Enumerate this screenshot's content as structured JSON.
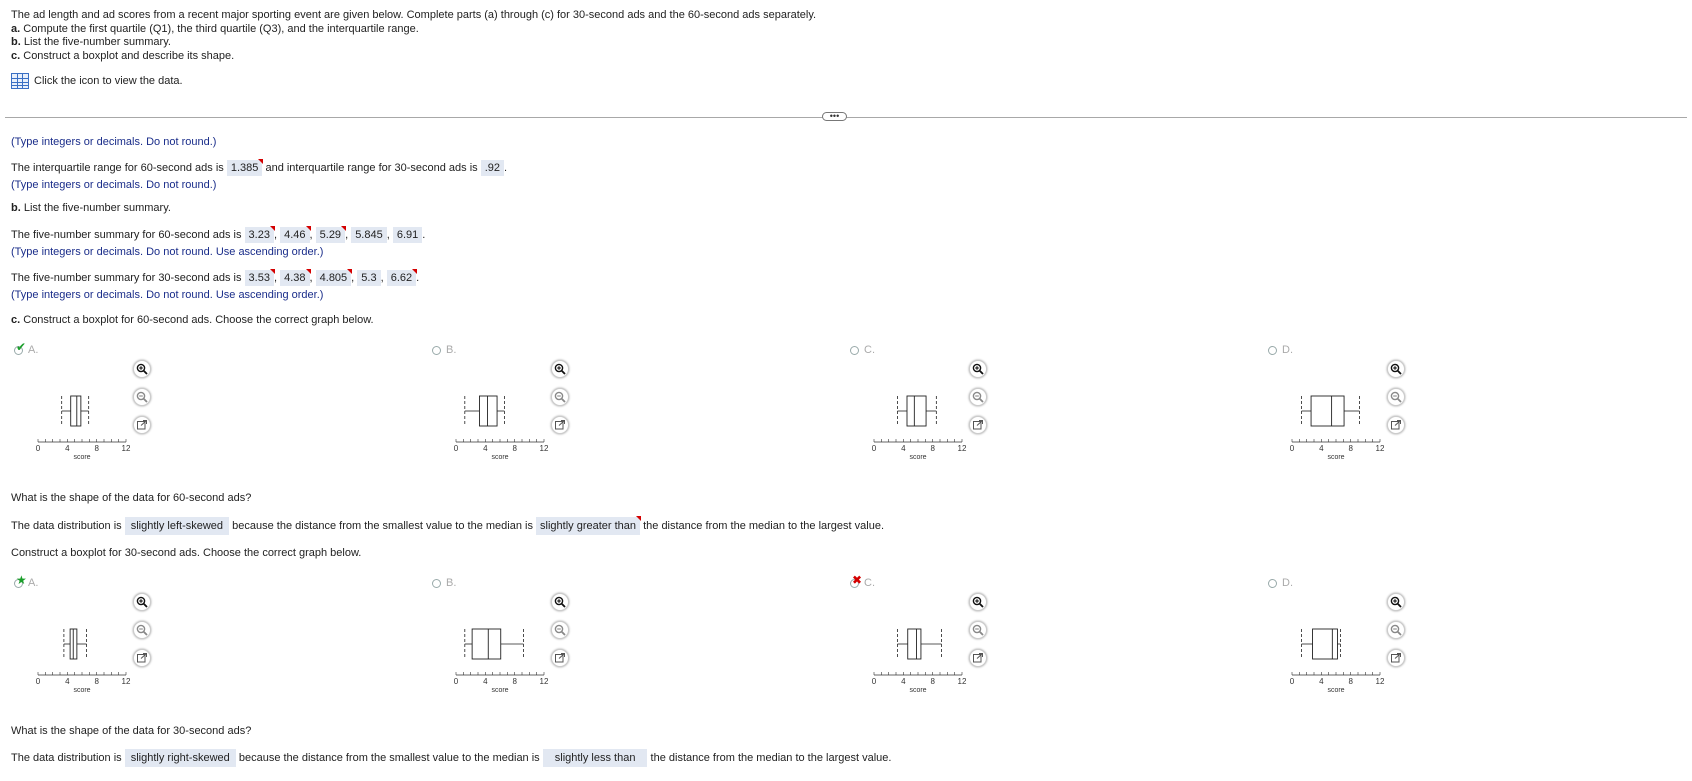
{
  "intro": {
    "line1": "The ad length and ad scores from a recent major sporting event are given below. Complete parts (a) through (c) for 30-second ads and the 60-second ads separately.",
    "a_label": "a.",
    "a_text": " Compute the first quartile (Q1), the third quartile (Q3), and the interquartile range.",
    "b_label": "b.",
    "b_text": " List the five-number summary.",
    "c_label": "c.",
    "c_text": " Construct a boxplot and describe its shape."
  },
  "data_link": "Click the icon to view the data.",
  "divider_handle": "•••",
  "hint_round": "(Type integers or decimals. Do not round.)",
  "iqr": {
    "pre": "The interquartile range for 60-second ads is",
    "iqr60": "1.385",
    "mid": "and interquartile range for 30-second ads is",
    "iqr30": ".92",
    "post": "."
  },
  "b_heading_label": "b.",
  "b_heading_text": " List the five-number summary.",
  "five60": {
    "pre": "The five-number summary for 60-second ads is",
    "values": [
      "3.23",
      "4.46",
      "5.29",
      "5.845",
      "6.91"
    ]
  },
  "five30": {
    "pre": "The five-number summary for 30-second ads is",
    "values": [
      "3.53",
      "4.38",
      "4.805",
      "5.3",
      "6.62"
    ]
  },
  "hint_asc": "(Type integers or decimals. Do not round. Use ascending order.)",
  "comma": ",",
  "period": ".",
  "c_heading_label": "c.",
  "c_heading_text": " Construct a boxplot for 60-second ads. Choose the correct graph below.",
  "q30_heading": "Construct a boxplot for 30-second ads. Choose the correct graph below.",
  "shape60_q": "What is the shape of the data for 60-second ads?",
  "shape30_q": "What is the shape of the data for 30-second ads?",
  "shape60": {
    "pre": "The data distribution is",
    "shape": "slightly left-skewed",
    "mid": "because the distance from the smallest value to the median is",
    "cmp": "slightly greater than",
    "post": "the distance from the median to the largest value."
  },
  "shape30": {
    "pre": "The data distribution is",
    "shape": "slightly right-skewed",
    "mid": "because the distance from the smallest value to the median is",
    "cmp": "slightly less than",
    "post": "the distance from the median to the largest value."
  },
  "options_letters": [
    "A.",
    "B.",
    "C.",
    "D."
  ],
  "axis": {
    "label": "score",
    "ticks": [
      "0",
      "4",
      "8",
      "12"
    ],
    "min": 0,
    "max": 12
  },
  "boxplots60": [
    {
      "min": 3.23,
      "q1": 4.46,
      "med": 5.29,
      "q3": 5.845,
      "max": 6.91
    },
    {
      "min": 1.2,
      "q1": 3.2,
      "med": 4.3,
      "q3": 5.6,
      "max": 6.6
    },
    {
      "min": 3.2,
      "q1": 4.5,
      "med": 5.5,
      "q3": 7.1,
      "max": 8.5
    },
    {
      "min": 1.3,
      "q1": 2.6,
      "med": 5.4,
      "q3": 7.1,
      "max": 9.2
    }
  ],
  "boxplots30": [
    {
      "min": 3.53,
      "q1": 4.38,
      "med": 4.805,
      "q3": 5.3,
      "max": 6.62
    },
    {
      "min": 1.2,
      "q1": 2.2,
      "med": 4.4,
      "q3": 6.1,
      "max": 9.2
    },
    {
      "min": 3.2,
      "q1": 4.6,
      "med": 5.8,
      "q3": 6.4,
      "max": 9.2
    },
    {
      "min": 1.3,
      "q1": 2.8,
      "med": 5.5,
      "q3": 6.2,
      "max": 6.6
    }
  ],
  "marks60": {
    "correct_index": 0
  },
  "marks30": {
    "correct_index": 0,
    "wrong_index": 2
  },
  "colors": {
    "hint": "#1a2d8a",
    "answer_bg": "#e2e8f2",
    "correct": "#1a9e2a",
    "wrong": "#d40000"
  }
}
